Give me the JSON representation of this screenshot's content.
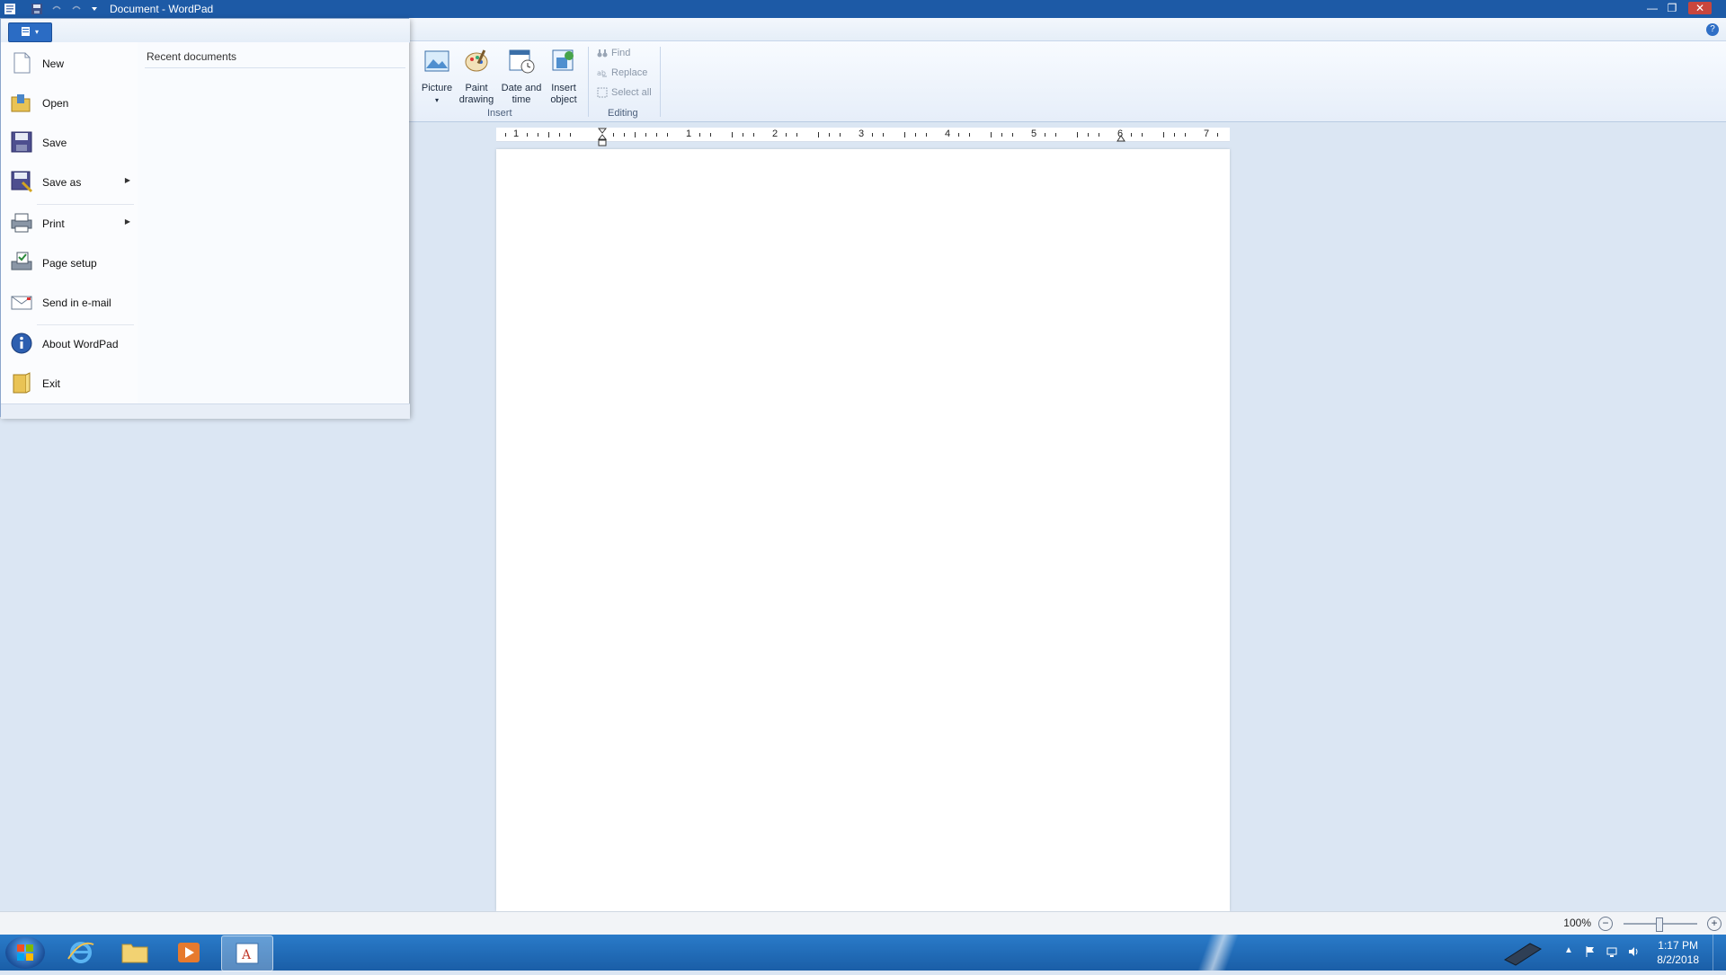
{
  "window": {
    "title": "Document - WordPad"
  },
  "ribbon": {
    "insert": {
      "label": "Insert",
      "buttons": [
        {
          "name": "picture-button",
          "label": "Picture",
          "icon": "picture-icon"
        },
        {
          "name": "paint-drawing-button",
          "label": "Paint\ndrawing",
          "icon": "paint-drawing-icon"
        },
        {
          "name": "date-time-button",
          "label": "Date and\ntime",
          "icon": "calendar-clock-icon"
        },
        {
          "name": "insert-object-button",
          "label": "Insert\nobject",
          "icon": "insert-object-icon"
        }
      ]
    },
    "editing": {
      "label": "Editing",
      "items": [
        {
          "name": "find-button",
          "label": "Find",
          "icon": "binoculars-icon"
        },
        {
          "name": "replace-button",
          "label": "Replace",
          "icon": "replace-icon"
        },
        {
          "name": "select-all-button",
          "label": "Select all",
          "icon": "select-all-icon"
        }
      ]
    }
  },
  "ruler": {
    "labels": [
      "1",
      "1",
      "2",
      "3",
      "4",
      "5",
      "6",
      "7"
    ]
  },
  "file_menu": {
    "items": [
      {
        "name": "new",
        "label": "New",
        "icon": "new-document-icon"
      },
      {
        "name": "open",
        "label": "Open",
        "icon": "open-folder-icon"
      },
      {
        "name": "save",
        "label": "Save",
        "icon": "save-disk-icon"
      },
      {
        "name": "save-as",
        "label": "Save as",
        "icon": "save-as-icon",
        "submenu": true
      },
      {
        "name": "print",
        "label": "Print",
        "icon": "printer-icon",
        "submenu": true
      },
      {
        "name": "page-setup",
        "label": "Page setup",
        "icon": "page-setup-icon"
      },
      {
        "name": "send-email",
        "label": "Send in e-mail",
        "icon": "email-icon"
      },
      {
        "name": "about",
        "label": "About WordPad",
        "icon": "info-icon"
      },
      {
        "name": "exit",
        "label": "Exit",
        "icon": "exit-icon"
      }
    ],
    "recent_title": "Recent documents"
  },
  "statusbar": {
    "zoom": "100%",
    "zoom_level": 1.0
  },
  "taskbar": {
    "time": "1:17 PM",
    "date": "8/2/2018"
  },
  "colors": {
    "titlebar": "#1d5aa6",
    "taskbar": "#1f67b5",
    "accent": "#2b6cc4"
  }
}
